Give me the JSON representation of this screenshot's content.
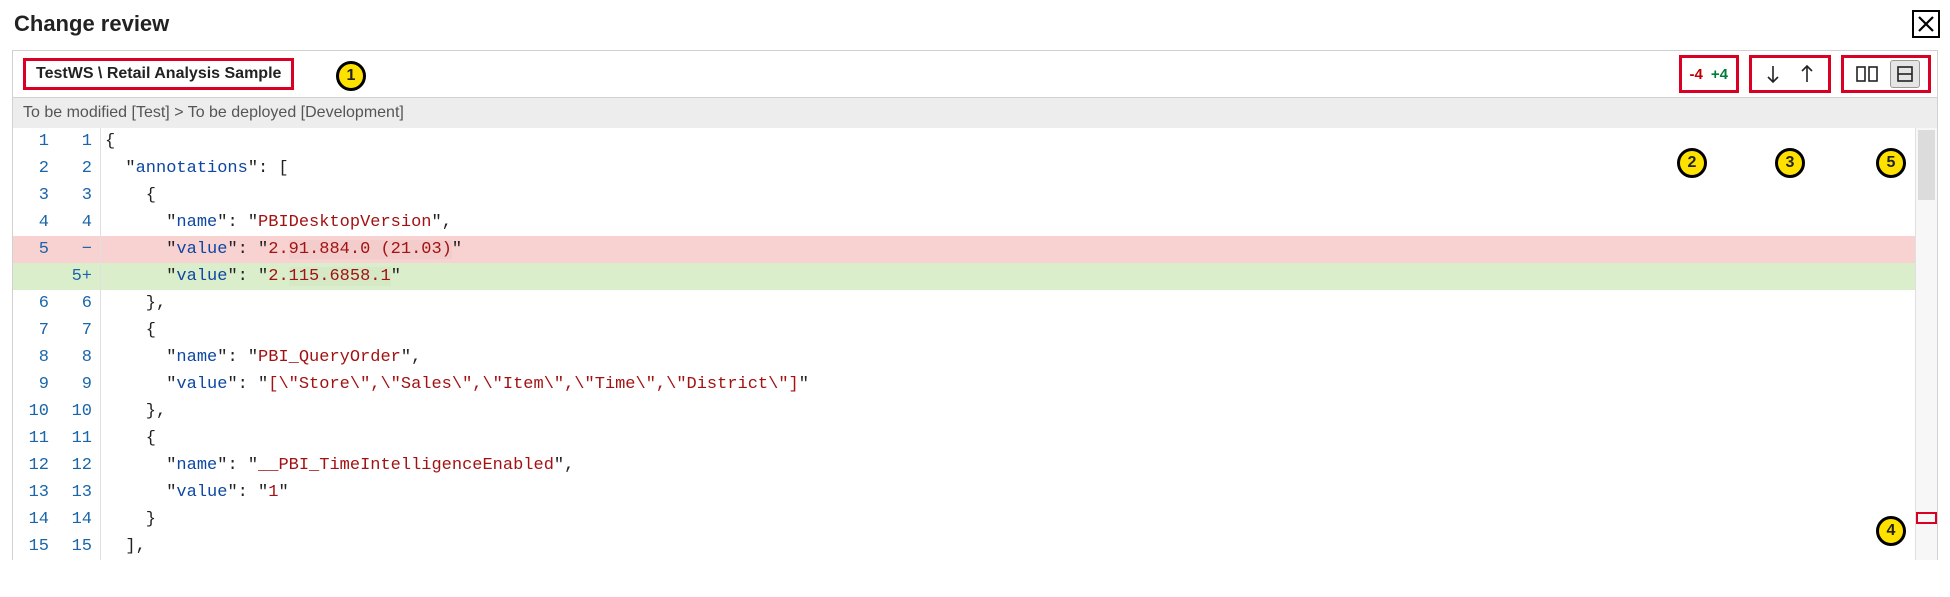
{
  "title": "Change review",
  "breadcrumb": "TestWS \\ Retail Analysis Sample",
  "counts": {
    "removed": "-4",
    "added": "+4"
  },
  "subheader": "To be modified [Test] > To be deployed [Development]",
  "callouts": {
    "c1": "1",
    "c2": "2",
    "c3": "3",
    "c4": "4",
    "c5": "5"
  },
  "code": {
    "rows": [
      {
        "l": "1",
        "r": "1",
        "type": "",
        "text": "{"
      },
      {
        "l": "2",
        "r": "2",
        "type": "",
        "text": "  KEYannotationsKEY: ["
      },
      {
        "l": "3",
        "r": "3",
        "type": "",
        "text": "    {"
      },
      {
        "l": "4",
        "r": "4",
        "type": "",
        "text": "      KEYnameKEY: STRPBIDesktopVersionSTR,"
      },
      {
        "l": "5",
        "r": "−",
        "type": "del",
        "text": "      KEYvalueKEY: STR2.HL91.884.0 (21.03)HLSTR"
      },
      {
        "l": "",
        "r": "5+",
        "type": "add",
        "text": "      KEYvalueKEY: STR2.HL115.6858.1HLSTR"
      },
      {
        "l": "6",
        "r": "6",
        "type": "",
        "text": "    },"
      },
      {
        "l": "7",
        "r": "7",
        "type": "",
        "text": "    {"
      },
      {
        "l": "8",
        "r": "8",
        "type": "",
        "text": "      KEYnameKEY: STRPBI_QueryOrderSTR,"
      },
      {
        "l": "9",
        "r": "9",
        "type": "",
        "text": "      KEYvalueKEY: STR[\\\"Store\\\",\\\"Sales\\\",\\\"Item\\\",\\\"Time\\\",\\\"District\\\"]STR"
      },
      {
        "l": "10",
        "r": "10",
        "type": "",
        "text": "    },"
      },
      {
        "l": "11",
        "r": "11",
        "type": "",
        "text": "    {"
      },
      {
        "l": "12",
        "r": "12",
        "type": "",
        "text": "      KEYnameKEY: STR__PBI_TimeIntelligenceEnabledSTR,"
      },
      {
        "l": "13",
        "r": "13",
        "type": "",
        "text": "      KEYvalueKEY: STR1STR"
      },
      {
        "l": "14",
        "r": "14",
        "type": "",
        "text": "    }"
      },
      {
        "l": "15",
        "r": "15",
        "type": "",
        "text": "  ],"
      }
    ]
  }
}
